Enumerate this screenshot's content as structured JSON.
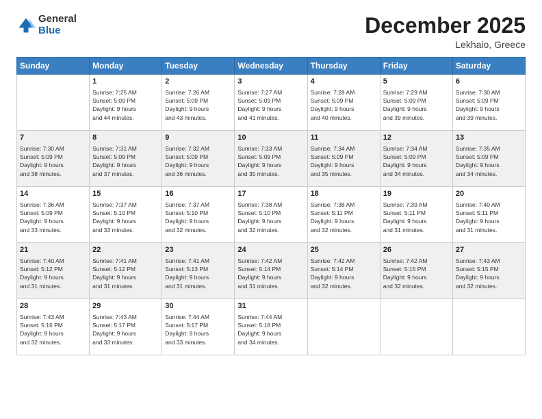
{
  "header": {
    "logo": {
      "general": "General",
      "blue": "Blue"
    },
    "title": "December 2025",
    "location": "Lekhaio, Greece"
  },
  "calendar": {
    "weekdays": [
      "Sunday",
      "Monday",
      "Tuesday",
      "Wednesday",
      "Thursday",
      "Friday",
      "Saturday"
    ],
    "weeks": [
      [
        {
          "day": "",
          "info": ""
        },
        {
          "day": "1",
          "info": "Sunrise: 7:25 AM\nSunset: 5:09 PM\nDaylight: 9 hours\nand 44 minutes."
        },
        {
          "day": "2",
          "info": "Sunrise: 7:26 AM\nSunset: 5:09 PM\nDaylight: 9 hours\nand 43 minutes."
        },
        {
          "day": "3",
          "info": "Sunrise: 7:27 AM\nSunset: 5:09 PM\nDaylight: 9 hours\nand 41 minutes."
        },
        {
          "day": "4",
          "info": "Sunrise: 7:28 AM\nSunset: 5:09 PM\nDaylight: 9 hours\nand 40 minutes."
        },
        {
          "day": "5",
          "info": "Sunrise: 7:29 AM\nSunset: 5:09 PM\nDaylight: 9 hours\nand 39 minutes."
        },
        {
          "day": "6",
          "info": "Sunrise: 7:30 AM\nSunset: 5:09 PM\nDaylight: 9 hours\nand 39 minutes."
        }
      ],
      [
        {
          "day": "7",
          "info": "Sunrise: 7:30 AM\nSunset: 5:09 PM\nDaylight: 9 hours\nand 38 minutes."
        },
        {
          "day": "8",
          "info": "Sunrise: 7:31 AM\nSunset: 5:09 PM\nDaylight: 9 hours\nand 37 minutes."
        },
        {
          "day": "9",
          "info": "Sunrise: 7:32 AM\nSunset: 5:09 PM\nDaylight: 9 hours\nand 36 minutes."
        },
        {
          "day": "10",
          "info": "Sunrise: 7:33 AM\nSunset: 5:09 PM\nDaylight: 9 hours\nand 35 minutes."
        },
        {
          "day": "11",
          "info": "Sunrise: 7:34 AM\nSunset: 5:09 PM\nDaylight: 9 hours\nand 35 minutes."
        },
        {
          "day": "12",
          "info": "Sunrise: 7:34 AM\nSunset: 5:09 PM\nDaylight: 9 hours\nand 34 minutes."
        },
        {
          "day": "13",
          "info": "Sunrise: 7:35 AM\nSunset: 5:09 PM\nDaylight: 9 hours\nand 34 minutes."
        }
      ],
      [
        {
          "day": "14",
          "info": "Sunrise: 7:36 AM\nSunset: 5:09 PM\nDaylight: 9 hours\nand 33 minutes."
        },
        {
          "day": "15",
          "info": "Sunrise: 7:37 AM\nSunset: 5:10 PM\nDaylight: 9 hours\nand 33 minutes."
        },
        {
          "day": "16",
          "info": "Sunrise: 7:37 AM\nSunset: 5:10 PM\nDaylight: 9 hours\nand 32 minutes."
        },
        {
          "day": "17",
          "info": "Sunrise: 7:38 AM\nSunset: 5:10 PM\nDaylight: 9 hours\nand 32 minutes."
        },
        {
          "day": "18",
          "info": "Sunrise: 7:38 AM\nSunset: 5:11 PM\nDaylight: 9 hours\nand 32 minutes."
        },
        {
          "day": "19",
          "info": "Sunrise: 7:39 AM\nSunset: 5:11 PM\nDaylight: 9 hours\nand 31 minutes."
        },
        {
          "day": "20",
          "info": "Sunrise: 7:40 AM\nSunset: 5:11 PM\nDaylight: 9 hours\nand 31 minutes."
        }
      ],
      [
        {
          "day": "21",
          "info": "Sunrise: 7:40 AM\nSunset: 5:12 PM\nDaylight: 9 hours\nand 31 minutes."
        },
        {
          "day": "22",
          "info": "Sunrise: 7:41 AM\nSunset: 5:12 PM\nDaylight: 9 hours\nand 31 minutes."
        },
        {
          "day": "23",
          "info": "Sunrise: 7:41 AM\nSunset: 5:13 PM\nDaylight: 9 hours\nand 31 minutes."
        },
        {
          "day": "24",
          "info": "Sunrise: 7:42 AM\nSunset: 5:14 PM\nDaylight: 9 hours\nand 31 minutes."
        },
        {
          "day": "25",
          "info": "Sunrise: 7:42 AM\nSunset: 5:14 PM\nDaylight: 9 hours\nand 32 minutes."
        },
        {
          "day": "26",
          "info": "Sunrise: 7:42 AM\nSunset: 5:15 PM\nDaylight: 9 hours\nand 32 minutes."
        },
        {
          "day": "27",
          "info": "Sunrise: 7:43 AM\nSunset: 5:15 PM\nDaylight: 9 hours\nand 32 minutes."
        }
      ],
      [
        {
          "day": "28",
          "info": "Sunrise: 7:43 AM\nSunset: 5:16 PM\nDaylight: 9 hours\nand 32 minutes."
        },
        {
          "day": "29",
          "info": "Sunrise: 7:43 AM\nSunset: 5:17 PM\nDaylight: 9 hours\nand 33 minutes."
        },
        {
          "day": "30",
          "info": "Sunrise: 7:44 AM\nSunset: 5:17 PM\nDaylight: 9 hours\nand 33 minutes."
        },
        {
          "day": "31",
          "info": "Sunrise: 7:44 AM\nSunset: 5:18 PM\nDaylight: 9 hours\nand 34 minutes."
        },
        {
          "day": "",
          "info": ""
        },
        {
          "day": "",
          "info": ""
        },
        {
          "day": "",
          "info": ""
        }
      ]
    ]
  }
}
